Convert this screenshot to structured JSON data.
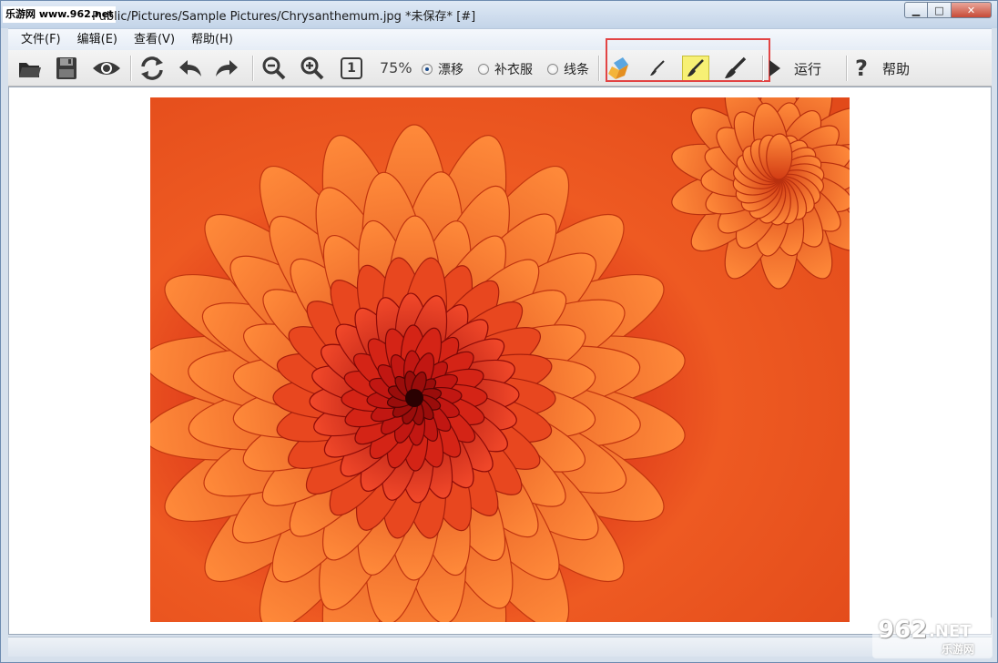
{
  "watermark": {
    "site": "乐游网 www.962.net",
    "logo_main": "962",
    "logo_net": ".NET",
    "logo_sub": "乐游网"
  },
  "window": {
    "title": "Public/Pictures/Sample Pictures/Chrysanthemum.jpg  *未保存* [#]",
    "controls": {
      "minimize": "▁",
      "maximize": "□",
      "close": "✕"
    }
  },
  "menu": [
    {
      "label": "文件(F)"
    },
    {
      "label": "编辑(E)"
    },
    {
      "label": "查看(V)"
    },
    {
      "label": "帮助(H)"
    }
  ],
  "toolbar": {
    "zoom_reset_label": "1",
    "zoom_level": "75%",
    "modes": [
      {
        "label": "漂移",
        "selected": true
      },
      {
        "label": "补衣服",
        "selected": false
      },
      {
        "label": "线条",
        "selected": false
      }
    ],
    "run_label": "运行",
    "help_label": "帮助",
    "highlight_color": "#f7f074",
    "annotation_color": "#e24444"
  },
  "image": {
    "name": "Chrysanthemum.jpg",
    "dominant_color": "#e4511f"
  }
}
